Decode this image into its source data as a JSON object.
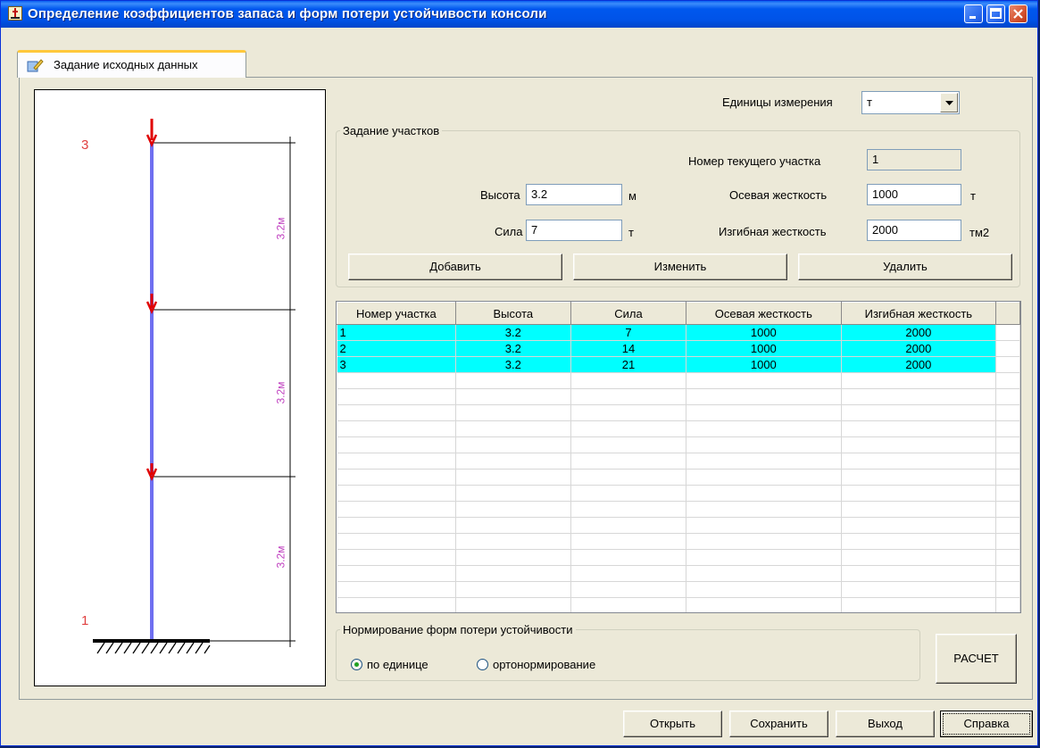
{
  "window": {
    "title": "Определение коэффициентов запаса и форм потери устойчивости консоли"
  },
  "tab": {
    "label": "Задание исходных данных"
  },
  "units": {
    "label": "Единицы измерения",
    "value": "т"
  },
  "sections_group": {
    "legend": "Задание участков",
    "current_label": "Номер текущего участка",
    "current_value": "1",
    "height_label": "Высота",
    "height_value": "3.2",
    "height_unit": "м",
    "force_label": "Сила",
    "force_value": "7",
    "force_unit": "т",
    "axial_label": "Осевая жесткость",
    "axial_value": "1000",
    "axial_unit": "т",
    "bending_label": "Изгибная жесткость",
    "bending_value": "2000",
    "bending_unit": "тм2",
    "add_button": "Добавить",
    "edit_button": "Изменить",
    "delete_button": "Удалить"
  },
  "table": {
    "columns": [
      "Номер участка",
      "Высота",
      "Сила",
      "Осевая жесткость",
      "Изгибная жесткость"
    ],
    "rows": [
      [
        "1",
        "3.2",
        "7",
        "1000",
        "2000"
      ],
      [
        "2",
        "3.2",
        "14",
        "1000",
        "2000"
      ],
      [
        "3",
        "3.2",
        "21",
        "1000",
        "2000"
      ]
    ]
  },
  "norm_group": {
    "legend": "Нормирование форм потери устойчивости",
    "option_unit": "по единице",
    "option_ortho": "ортонормирование",
    "selected": "по единице"
  },
  "calc_button": "РАСЧЕТ",
  "bottom_buttons": {
    "open": "Открыть",
    "save": "Сохранить",
    "exit": "Выход",
    "help": "Справка"
  },
  "drawing": {
    "node_top": "3",
    "node_bottom": "1",
    "dim_labels": [
      "3.2м",
      "3.2м",
      "3.2м"
    ],
    "colors": {
      "column": "#6f6ff0",
      "force": "#e00000",
      "dim_text": "#c040c0",
      "node": "#e04040"
    }
  }
}
